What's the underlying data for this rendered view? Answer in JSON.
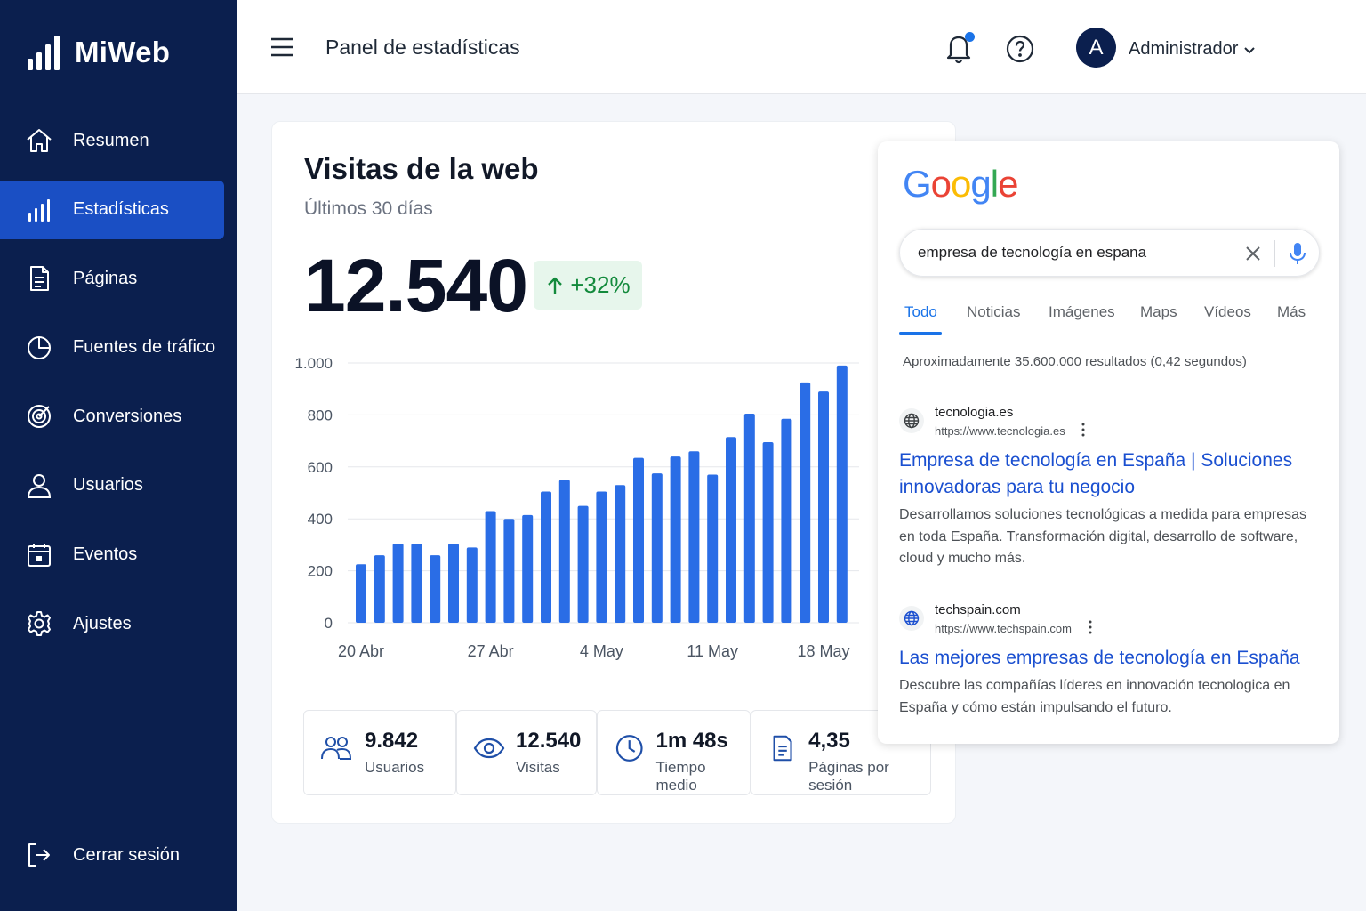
{
  "sidebar": {
    "brand": "MiWeb",
    "items": [
      {
        "label": "Resumen",
        "icon": "home-icon"
      },
      {
        "label": "Estadísticas",
        "icon": "bar-chart-icon"
      },
      {
        "label": "Páginas",
        "icon": "document-icon"
      },
      {
        "label": "Fuentes de tráfico",
        "icon": "pie-chart-icon"
      },
      {
        "label": "Conversiones",
        "icon": "target-icon"
      },
      {
        "label": "Usuarios",
        "icon": "user-icon"
      },
      {
        "label": "Eventos",
        "icon": "calendar-icon"
      },
      {
        "label": "Ajustes",
        "icon": "gear-icon"
      }
    ],
    "active_index": 1,
    "logout": "Cerrar sesión"
  },
  "header": {
    "title": "Panel de estadísticas",
    "avatar_initial": "A",
    "user_name": "Administrador"
  },
  "card": {
    "title": "Visitas de la web",
    "subtitle": "Últimos 30 días",
    "total": "12.540",
    "growth": "+32%"
  },
  "chart_data": {
    "type": "bar",
    "title": "",
    "xlabel": "",
    "ylabel": "",
    "ylim": [
      0,
      1000
    ],
    "yticks": [
      0,
      200,
      400,
      600,
      800,
      1000
    ],
    "ytick_labels": [
      "0",
      "200",
      "400",
      "600",
      "800",
      "1.000"
    ],
    "xtick_labels": [
      "20 Abr",
      "27 Abr",
      "4 May",
      "11 May",
      "18 May"
    ],
    "xtick_indices": [
      0,
      7,
      13,
      19,
      25
    ],
    "grid": true,
    "color": "#2a6de6",
    "values": [
      225,
      260,
      305,
      305,
      260,
      305,
      290,
      430,
      400,
      415,
      505,
      550,
      450,
      505,
      530,
      635,
      575,
      640,
      660,
      570,
      715,
      805,
      695,
      785,
      925,
      890,
      990
    ]
  },
  "stats": [
    {
      "value": "9.842",
      "label": "Usuarios",
      "icon": "users-icon"
    },
    {
      "value": "12.540",
      "label": "Visitas",
      "icon": "eye-icon"
    },
    {
      "value": "1m 48s",
      "label": "Tiempo medio",
      "icon": "clock-icon"
    },
    {
      "value": "4,35",
      "label": "Páginas por sesión",
      "icon": "document-icon"
    }
  ],
  "google": {
    "logo": [
      "G",
      "o",
      "o",
      "g",
      "l",
      "e"
    ],
    "logo_colors": [
      "#4285F4",
      "#EA4335",
      "#FBBC05",
      "#4285F4",
      "#34A853",
      "#EA4335"
    ],
    "query": "empresa de tecnología en espana",
    "tabs": [
      "Todo",
      "Noticias",
      "Imágenes",
      "Maps",
      "Vídeos",
      "Más"
    ],
    "results_count": "Aproximadamente 35.600.000 resultados (0,42 segundos)",
    "results": [
      {
        "site": "tecnologia.es",
        "url": "https://www.tecnologia.es",
        "title_lines": [
          "Empresa de tecnología en España | Soluciones",
          "innovadoras para tu negocio"
        ],
        "snippet_lines": [
          "Desarrollamos soluciones tecnológicas a medida para empresas",
          "en toda España. Transformación digital, desarrollo de software,",
          "cloud y mucho más."
        ]
      },
      {
        "site": "techspain.com",
        "url": "https://www.techspain.com",
        "title_lines": [
          "Las mejores empresas de tecnología en España"
        ],
        "snippet_lines": [
          "Descubre las compañías líderes en innovación tecnologica en",
          "España y cómo están impulsando el futuro."
        ]
      }
    ]
  }
}
